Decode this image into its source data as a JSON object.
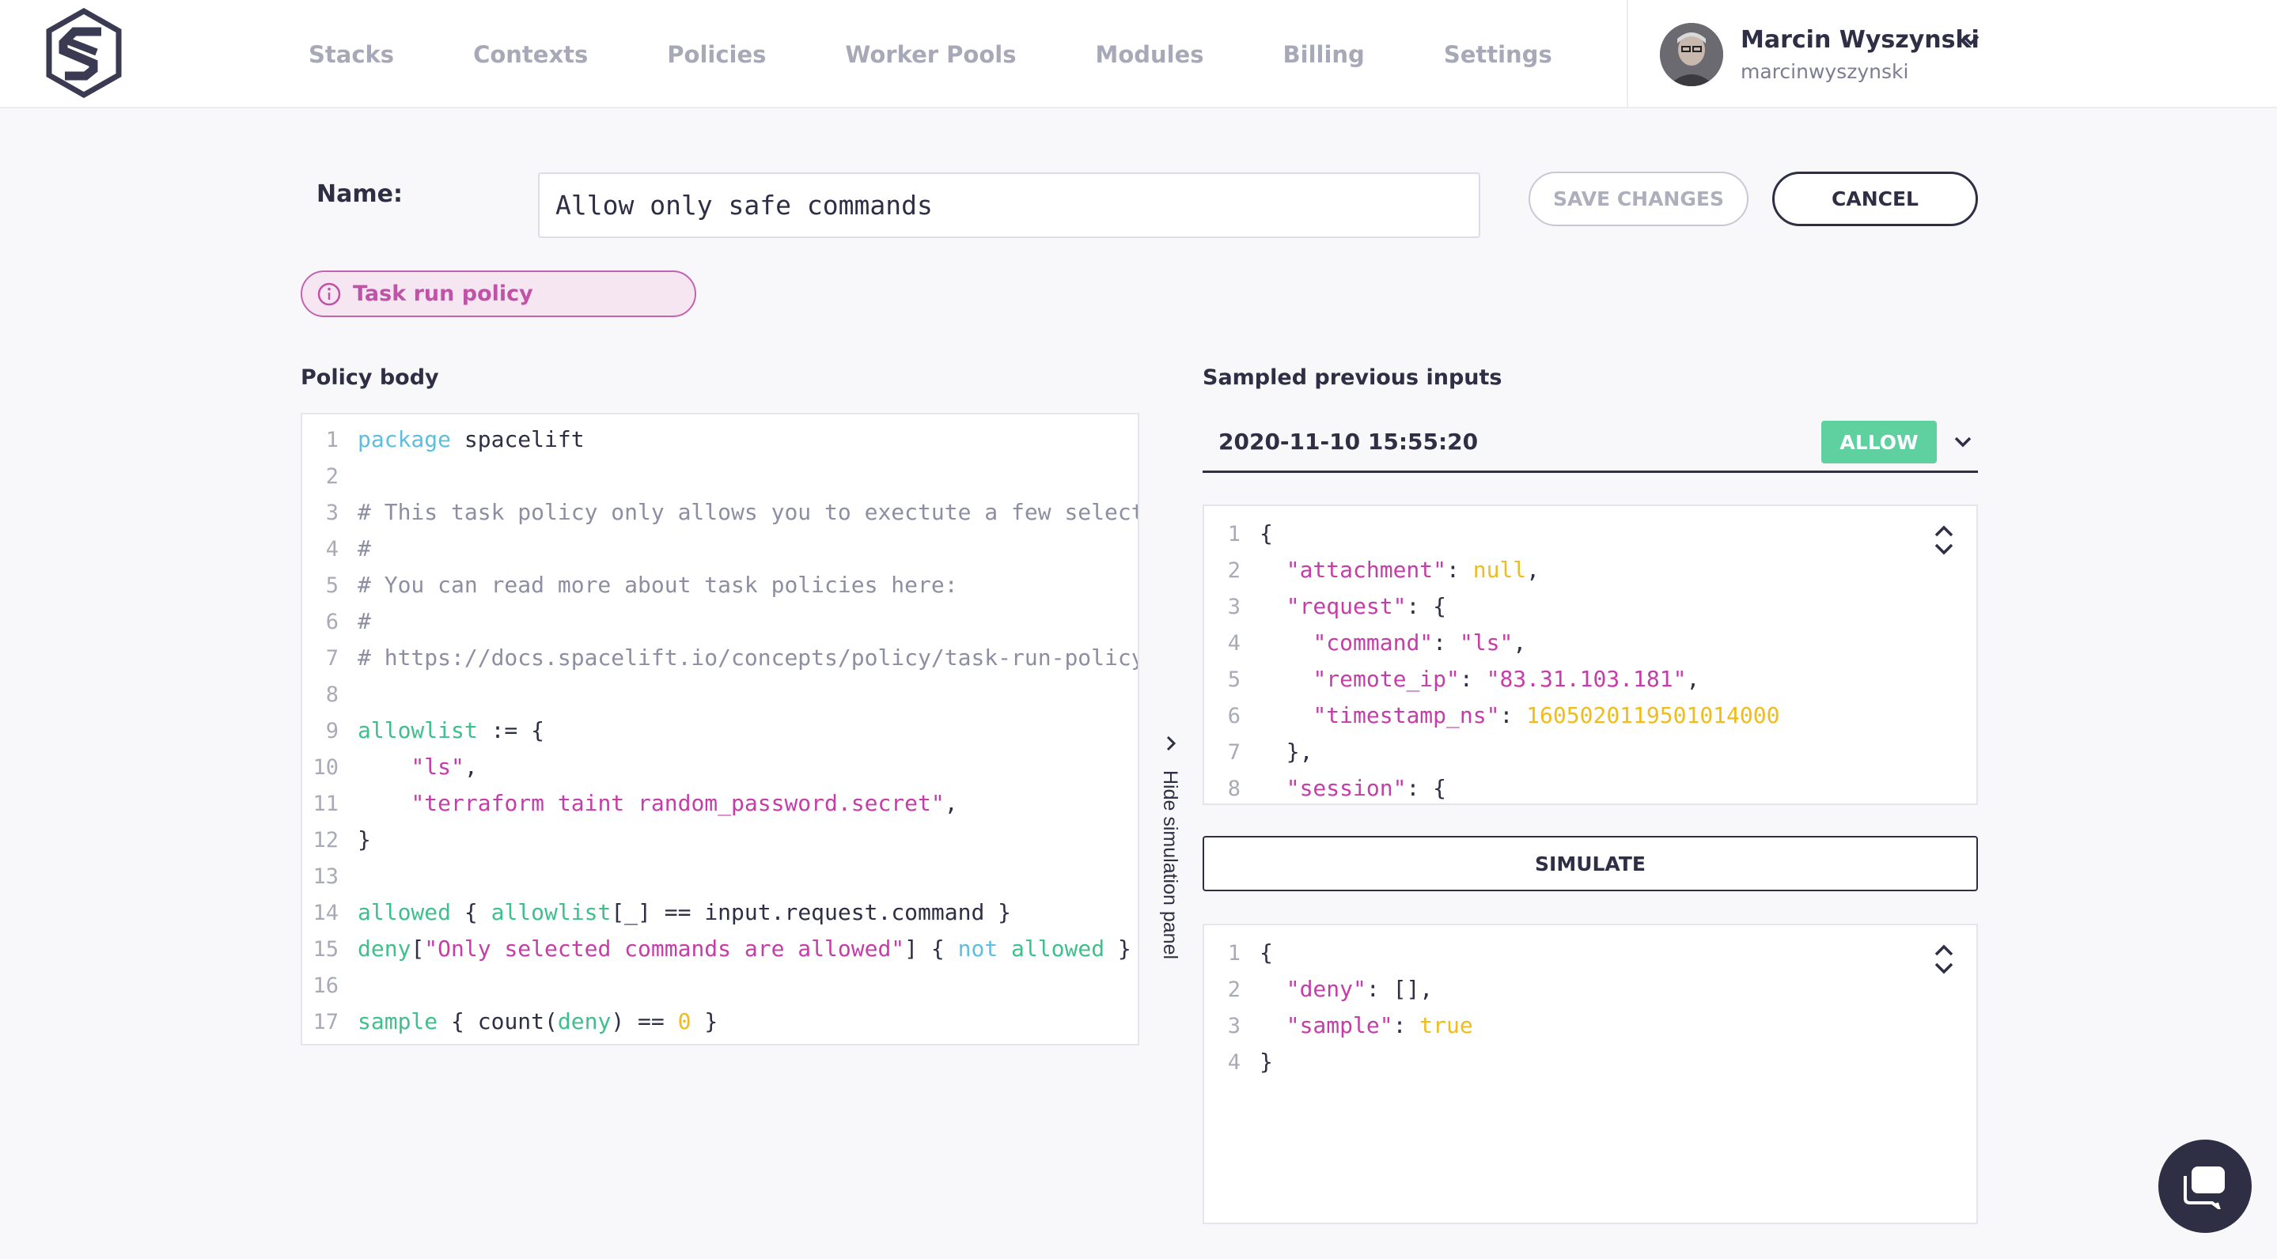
{
  "nav": {
    "items": [
      "Stacks",
      "Contexts",
      "Policies",
      "Worker Pools",
      "Modules",
      "Billing",
      "Settings"
    ]
  },
  "user": {
    "name": "Marcin Wyszynski",
    "handle": "marcinwyszynski"
  },
  "form": {
    "name_label": "Name:",
    "name_value": "Allow only safe commands",
    "save_label": "SAVE CHANGES",
    "cancel_label": "CANCEL",
    "policy_type": "Task run policy"
  },
  "policy_body": {
    "title": "Policy body",
    "lines": [
      "package spacelift",
      "",
      "# This task policy only allows you to exectute a few selected",
      "#",
      "# You can read more about task policies here:",
      "#",
      "# https://docs.spacelift.io/concepts/policy/task-run-policy",
      "",
      "allowlist := {",
      "    \"ls\",",
      "    \"terraform taint random_password.secret\",",
      "}",
      "",
      "allowed { allowlist[_] == input.request.command }",
      "deny[\"Only selected commands are allowed\"] { not allowed }",
      "",
      "sample { count(deny) == 0 }"
    ]
  },
  "simulation": {
    "title": "Sampled previous inputs",
    "selected_date": "2020-11-10 15:55:20",
    "decision": "ALLOW",
    "toggle_label": "Hide simulation panel",
    "simulate_label": "SIMULATE",
    "input_lines": [
      "{",
      "  \"attachment\": null,",
      "  \"request\": {",
      "    \"command\": \"ls\",",
      "    \"remote_ip\": \"83.31.103.181\",",
      "    \"timestamp_ns\": 1605020119501014000",
      "  },",
      "  \"session\": {"
    ],
    "output_lines": [
      "{",
      "  \"deny\": [],",
      "  \"sample\": true",
      "}"
    ]
  },
  "colors": {
    "text": "#2e2f45",
    "allow": "#5fd0a0",
    "policy_badge": "#c053a8",
    "keyword_blue": "#5fbde0",
    "keyword_green": "#3fbf8e",
    "string": "#c53da8",
    "number": "#f1bb1a"
  },
  "icons": [
    "spacelift-logo",
    "chevron-down-icon",
    "info-icon",
    "chevron-right-icon",
    "expand-collapse-icon",
    "chat-icon"
  ]
}
